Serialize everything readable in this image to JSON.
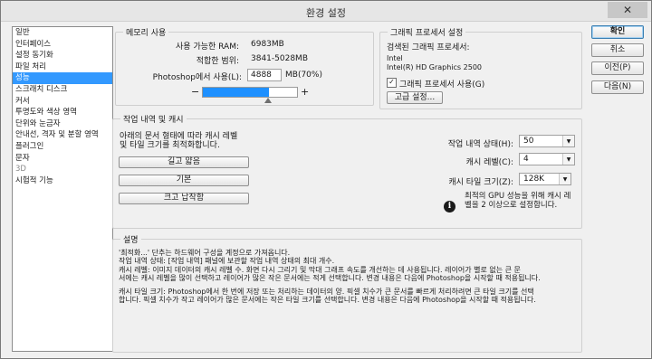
{
  "window": {
    "title": "환경 설정",
    "close": "✕"
  },
  "sidebar": {
    "items": [
      {
        "label": "일반"
      },
      {
        "label": "인터페이스"
      },
      {
        "label": "설정 동기화"
      },
      {
        "label": "파일 처리"
      },
      {
        "label": "성능"
      },
      {
        "label": "스크래치 디스크"
      },
      {
        "label": "커서"
      },
      {
        "label": "투명도와 색상 영역"
      },
      {
        "label": "단위와 눈금자"
      },
      {
        "label": "안내선, 격자 및 분할 영역"
      },
      {
        "label": "플러그인"
      },
      {
        "label": "문자"
      },
      {
        "label": "3D"
      },
      {
        "label": "시험적 기능"
      }
    ]
  },
  "memory": {
    "title": "메모리 사용",
    "available_label": "사용 가능한 RAM:",
    "available_value": "6983MB",
    "ideal_label": "적합한 범위:",
    "ideal_value": "3841-5028MB",
    "usage_label": "Photoshop에서 사용(L):",
    "usage_value": "4888",
    "usage_unit": "MB(70%)",
    "slider_fraction": 0.7,
    "minus": "−",
    "plus": "+"
  },
  "gpu": {
    "title": "그래픽 프로세서 설정",
    "detected_label": "검색된 그래픽 프로세서:",
    "vendor": "Intel",
    "model": "Intel(R) HD Graphics 2500",
    "use_gpu_label": "그래픽 프로세서 사용(G)",
    "check_mark": "✓",
    "advanced_button": "고급 설정..."
  },
  "history": {
    "title": "작업 내역 및 캐시",
    "hint": "아래의 문서 형태에 따라 캐시 레벨\n및 타일 크기를 최적화합니다.",
    "buttons": [
      "길고 얇음",
      "기본",
      "크고 납작함"
    ],
    "history_states_label": "작업 내역 상태(H):",
    "history_states_value": "50",
    "cache_levels_label": "캐시 레벨(C):",
    "cache_levels_value": "4",
    "cache_tile_label": "캐시 타일 크기(Z):",
    "cache_tile_value": "128K",
    "info_icon": "i",
    "info_text": "최적의 GPU 성능을 위해 캐시 레\n벨을 2 이상으로 설정합니다.",
    "arrow": "▼"
  },
  "description": {
    "title": "설명",
    "lines": [
      "'최적화...' 단추는 하드웨어 구성을 계정으로 가져옵니다.",
      "작업 내역 상태: [작업 내역] 패널에 보관할 작업 내역 상태의 최대 개수.",
      "캐시 레벨: 이미지 데이터의 캐시 레벨 수. 화면 다시 그리기 및 막대 그래프 속도를 개선하는 데 사용됩니다. 레이어가 별로 없는 큰 문",
      "서에는 캐시 레벨을 많이 선택하고 레이어가 많은 작은 문서에는 적게 선택합니다. 변경 내용은 다음에 Photoshop을 시작할 때 적용됩니다.",
      "캐시 타일 크기: Photoshop에서 한 번에 저장 또는 처리하는 데이터의 양. 픽셀 치수가 큰 문서를 빠르게 처리하려면 큰 타일 크기를 선택",
      "합니다. 픽셀 치수가 작고 레이어가 많은 문서에는 작은 타일 크기를 선택합니다. 변경 내용은 다음에 Photoshop을 시작할 때 적용됩니다."
    ]
  },
  "actions": {
    "ok": "확인",
    "cancel": "취소",
    "prev": "이전(P)",
    "next": "다음(N)"
  },
  "colors": {
    "selection": "#3399ff",
    "slider_fill": "#1e90ff"
  }
}
